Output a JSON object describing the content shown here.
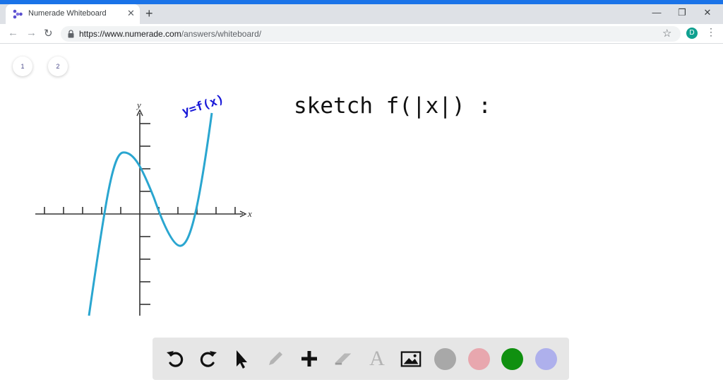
{
  "browser": {
    "tab_title": "Numerade Whiteboard",
    "tab_close": "✕",
    "new_tab": "+",
    "url_host": "https://www.numerade.com",
    "url_path": "/answers/whiteboard/",
    "profile_initial": "D",
    "window_controls": [
      "—",
      "❐",
      "✕"
    ]
  },
  "pages": [
    "1",
    "2"
  ],
  "graph": {
    "x_axis_label": "x",
    "y_axis_label": "y",
    "curve_label": "y=f(x)",
    "x_ticks": [
      -5,
      -4,
      -3,
      -2,
      -1,
      1,
      2,
      3,
      4,
      5
    ],
    "y_ticks": [
      -4,
      -3,
      -2,
      -1,
      1,
      2,
      3,
      4
    ]
  },
  "handwriting": {
    "prompt": "sketch  f(|x|) :"
  },
  "toolbar": {
    "tools": [
      "undo-icon",
      "redo-icon",
      "select-icon",
      "pen-icon",
      "add-icon",
      "eraser-icon",
      "text-icon",
      "image-icon"
    ],
    "text_tool_glyph": "A",
    "colors": [
      "#a8a8a8",
      "#e8a7ae",
      "#109010",
      "#aeb0ec"
    ]
  },
  "colors": {
    "curve": "#2aa6d0",
    "curve_label": "#1818d8",
    "ink": "#111111"
  }
}
